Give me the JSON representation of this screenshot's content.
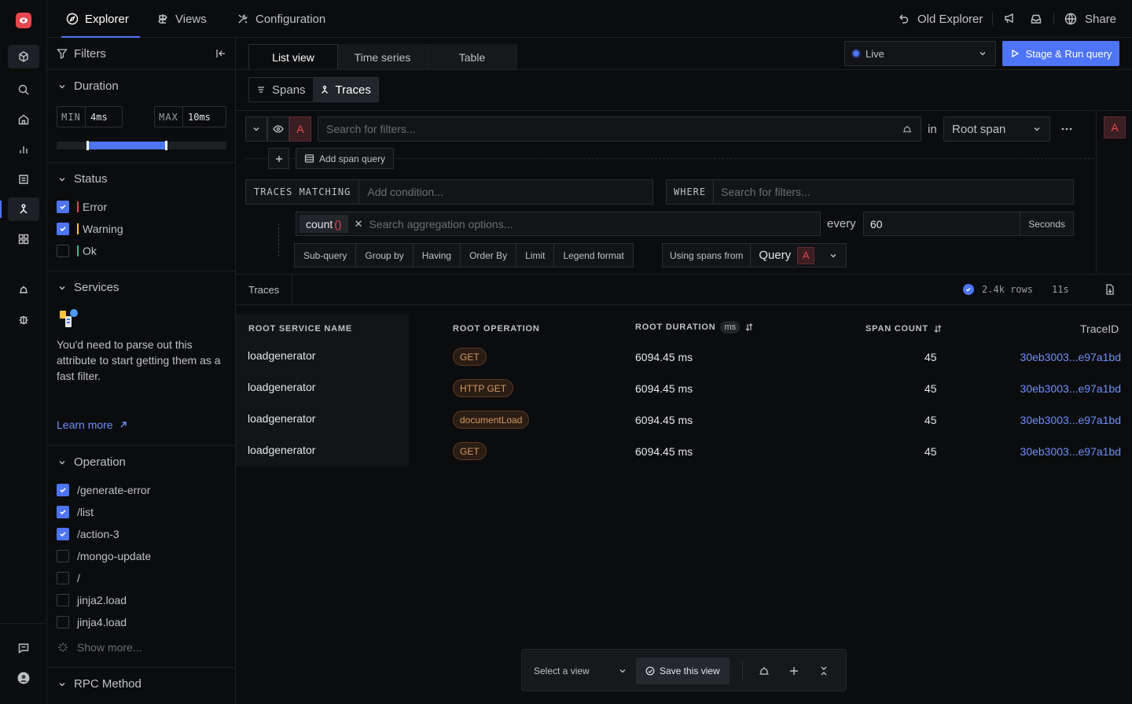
{
  "nav": {
    "tabs": [
      {
        "label": "Explorer",
        "icon": "compass-icon"
      },
      {
        "label": "Views",
        "icon": "sign-icon"
      },
      {
        "label": "Configuration",
        "icon": "tools-icon"
      }
    ],
    "old_explorer": "Old Explorer",
    "share": "Share"
  },
  "filters": {
    "title": "Filters",
    "duration": {
      "title": "Duration",
      "min_label": "MIN",
      "min_value": "4ms",
      "max_label": "MAX",
      "max_value": "10ms",
      "range_fraction": [
        0.18,
        0.65
      ]
    },
    "status": {
      "title": "Status",
      "items": [
        {
          "label": "Error",
          "checked": true,
          "color": "#e5484d"
        },
        {
          "label": "Warning",
          "checked": true,
          "color": "#f5c542"
        },
        {
          "label": "Ok",
          "checked": false,
          "color": "#2fbf8f"
        }
      ]
    },
    "services": {
      "title": "Services",
      "message": "You'd need to parse out this attribute to start getting them as a fast filter.",
      "learn_more": "Learn more"
    },
    "operation": {
      "title": "Operation",
      "items": [
        {
          "label": "/generate-error",
          "checked": true
        },
        {
          "label": "/list",
          "checked": true
        },
        {
          "label": "/action-3",
          "checked": true
        },
        {
          "label": "/mongo-update",
          "checked": false
        },
        {
          "label": "/",
          "checked": false
        },
        {
          "label": "jinja2.load",
          "checked": false
        },
        {
          "label": "jinja4.load",
          "checked": false
        }
      ],
      "show_more": "Show more..."
    },
    "rpc": {
      "title": "RPC Method"
    }
  },
  "main": {
    "view_tabs": [
      "List view",
      "Time series",
      "Table"
    ],
    "live_label": "Live",
    "run_button": "Stage & Run query",
    "mode_tabs": [
      "Spans",
      "Traces"
    ],
    "query": {
      "label": "A",
      "search_placeholder": "Search for filters...",
      "in_label": "in",
      "root_span": "Root span",
      "add_span_query": "Add span query",
      "traces_matching": "TRACES MATCHING",
      "add_condition": "Add condition...",
      "where": "WHERE",
      "where_placeholder": "Search for filters...",
      "agg_func": "count",
      "agg_parens": "()",
      "agg_placeholder": "Search aggregation options...",
      "every_label": "every",
      "every_value": "60",
      "every_unit": "Seconds",
      "options": [
        "Sub-query",
        "Group by",
        "Having",
        "Order By",
        "Limit",
        "Legend format"
      ],
      "using_spans_from": "Using spans from",
      "using_value": "Query",
      "using_label": "A"
    },
    "results": {
      "tab": "Traces",
      "rows_count": "2.4k rows",
      "elapsed": "11s",
      "columns": {
        "service": "ROOT SERVICE NAME",
        "operation": "ROOT OPERATION",
        "duration": "ROOT DURATION",
        "duration_unit": "ms",
        "span_count": "SPAN COUNT",
        "trace_id": "TraceID"
      },
      "rows": [
        {
          "service": "loadgenerator",
          "operation": "GET",
          "duration": "6094.45 ms",
          "span_count": "45",
          "trace_id": "30eb3003...e97a1bd"
        },
        {
          "service": "loadgenerator",
          "operation": "HTTP GET",
          "duration": "6094.45 ms",
          "span_count": "45",
          "trace_id": "30eb3003...e97a1bd"
        },
        {
          "service": "loadgenerator",
          "operation": "documentLoad",
          "duration": "6094.45 ms",
          "span_count": "45",
          "trace_id": "30eb3003...e97a1bd"
        },
        {
          "service": "loadgenerator",
          "operation": "GET",
          "duration": "6094.45 ms",
          "span_count": "45",
          "trace_id": "30eb3003...e97a1bd"
        }
      ]
    },
    "view_bar": {
      "select_placeholder": "Select a view",
      "save_label": "Save this view"
    }
  }
}
